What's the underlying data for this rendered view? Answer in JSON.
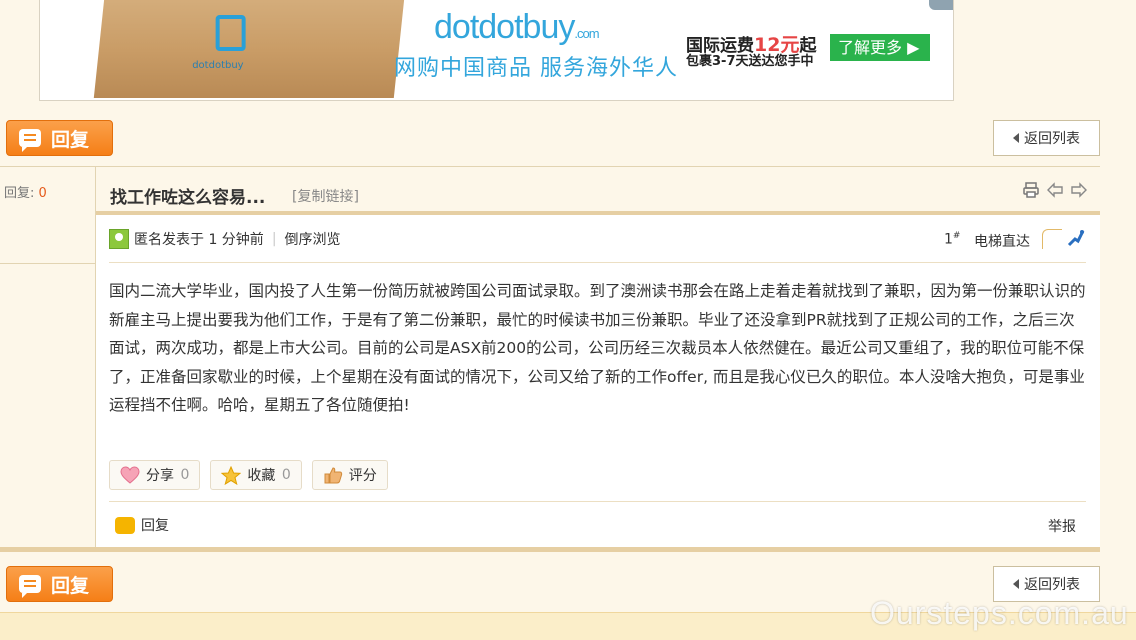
{
  "ad": {
    "brand": "dotdotbuy",
    "brand_suffix": ".com",
    "box_label": "dotdotbuy",
    "tagline": "网购中国商品 服务海外华人",
    "shipping_prefix": "国际运费",
    "shipping_price": "12元",
    "shipping_suffix": "起",
    "shipping_detail": "包裹3-7天送达您手中",
    "cta": "了解更多 ▶"
  },
  "toolbar": {
    "reply_label": "回复",
    "back_label": "返回列表"
  },
  "thread": {
    "reply_count_label": "回复:",
    "reply_count": "0",
    "title": "找工作咗这么容易...",
    "copy_link": "[复制链接]"
  },
  "post": {
    "author": "匿名",
    "posted_prefix": "发表于",
    "posted_time": "1 分钟前",
    "reverse_view": "倒序浏览",
    "floor_number": "1",
    "floor_mark": "#",
    "elevator_label": "电梯直达",
    "content": "国内二流大学毕业，国内投了人生第一份简历就被跨国公司面试录取。到了澳洲读书那会在路上走着走着就找到了兼职，因为第一份兼职认识的新雇主马上提出要我为他们工作，于是有了第二份兼职，最忙的时候读书加三份兼职。毕业了还没拿到PR就找到了正规公司的工作，之后三次面试，两次成功，都是上市大公司。目前的公司是ASX前200的公司，公司历经三次裁员本人依然健在。最近公司又重组了，我的职位可能不保了，正准备回家歇业的时候，上个星期在没有面试的情况下，公司又给了新的工作offer, 而且是我心仪已久的职位。本人没啥大抱负，可是事业运程挡不住啊。哈哈，星期五了各位随便拍!",
    "actions": {
      "share_label": "分享",
      "share_count": "0",
      "favorite_label": "收藏",
      "favorite_count": "0",
      "rate_label": "评分"
    },
    "reply_label": "回复",
    "report_label": "举报"
  },
  "watermark": "Oursteps.com.au",
  "colors": {
    "accent_orange": "#f57f17",
    "page_bg": "#fdf7e9",
    "count_red": "#e55a1b"
  }
}
